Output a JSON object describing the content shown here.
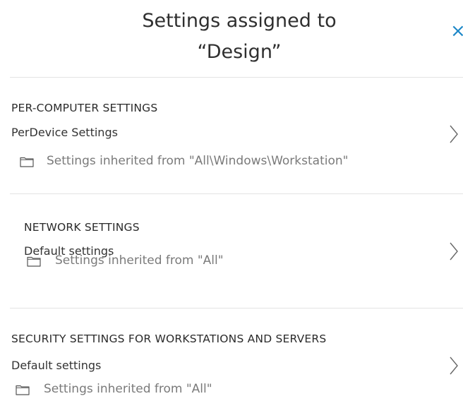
{
  "header": {
    "title_line1": "Settings assigned to",
    "title_line2": "“Design”",
    "close_glyph": "×"
  },
  "sections": [
    {
      "title": "PER-COMPUTER SETTINGS",
      "value": "PerDevice Settings",
      "inherited": "Settings inherited from \"All\\Windows\\Workstation\""
    },
    {
      "title": "NETWORK SETTINGS",
      "value": "Default settings",
      "inherited": "Settings inherited from \"All\""
    },
    {
      "title": "SECURITY SETTINGS FOR WORKSTATIONS AND SERVERS",
      "value": "Default settings",
      "inherited": "Settings inherited from \"All\""
    }
  ],
  "colors": {
    "accent": "#1e88c8",
    "divider": "#e3e3e3",
    "muted_text": "#7a7a7a"
  },
  "icons": {
    "close": "close-icon",
    "folder": "folder-icon",
    "chevron": "chevron-right-icon"
  }
}
